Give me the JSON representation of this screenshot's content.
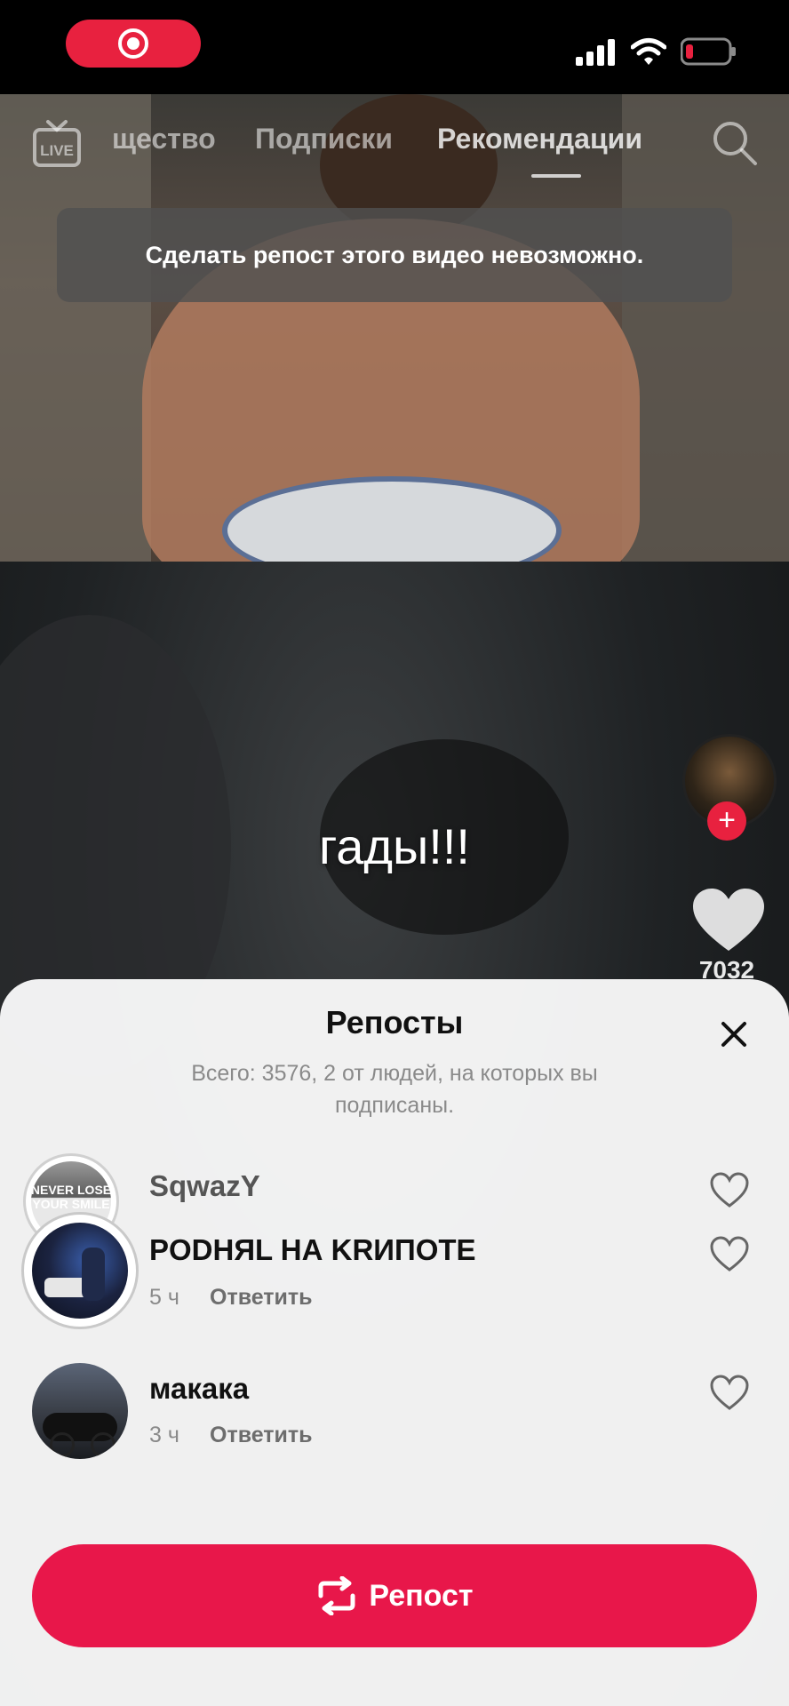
{
  "nav": {
    "tabs": [
      "щество",
      "Подписки",
      "Рекомендации"
    ],
    "live_label": "LIVE"
  },
  "toast": {
    "message": "Сделать репост этого видео невозможно."
  },
  "video": {
    "caption": "гады!!!",
    "like_count": "7032"
  },
  "sheet": {
    "title": "Репосты",
    "subtitle": "Всего: 3576, 2 от людей, на которых вы подписаны.",
    "rows": [
      {
        "name": "SqwazY",
        "avatar_text": "NEVER LOSE YOUR SMILE"
      },
      {
        "name": "PODHЯL НА KRИПОТЕ",
        "time": "5 ч",
        "reply": "Ответить"
      },
      {
        "name": "макака",
        "time": "3 ч",
        "reply": "Ответить"
      }
    ],
    "repost_button": "Репост"
  },
  "colors": {
    "accent": "#e8174a",
    "record": "#e8213f"
  }
}
